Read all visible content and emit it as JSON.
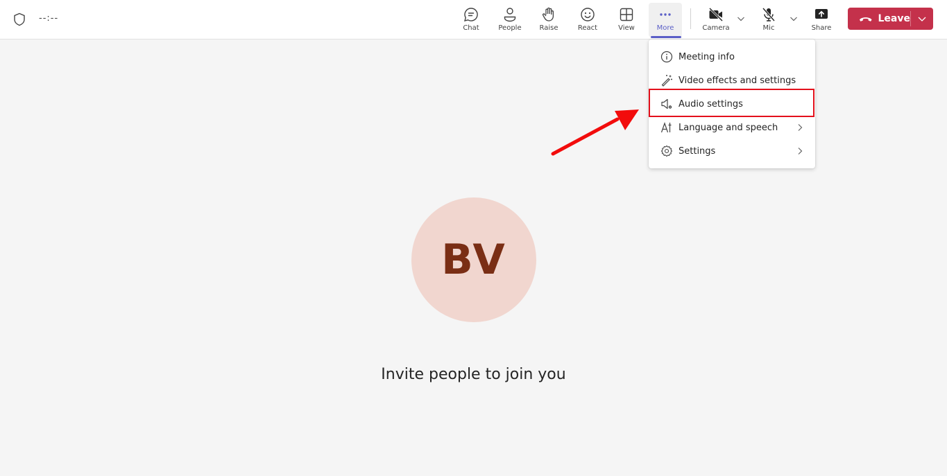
{
  "header": {
    "timer": "--:--",
    "toolbar": [
      {
        "id": "chat",
        "label": "Chat",
        "icon": "chat-icon"
      },
      {
        "id": "people",
        "label": "People",
        "icon": "people-icon"
      },
      {
        "id": "raise",
        "label": "Raise",
        "icon": "hand-icon"
      },
      {
        "id": "react",
        "label": "React",
        "icon": "smiley-icon"
      },
      {
        "id": "view",
        "label": "View",
        "icon": "grid-icon"
      },
      {
        "id": "more",
        "label": "More",
        "icon": "more-icon",
        "active": true
      },
      {
        "id": "camera",
        "label": "Camera",
        "icon": "camera-off-icon"
      },
      {
        "id": "mic",
        "label": "Mic",
        "icon": "mic-off-icon"
      },
      {
        "id": "share",
        "label": "Share",
        "icon": "share-icon"
      }
    ],
    "leave_label": "Leave"
  },
  "more_menu": {
    "items": [
      {
        "label": "Meeting info",
        "icon": "info-icon",
        "submenu": false
      },
      {
        "label": "Video effects and settings",
        "icon": "magic-wand-icon",
        "submenu": false
      },
      {
        "label": "Audio settings",
        "icon": "speaker-settings-icon",
        "submenu": false,
        "highlighted": true
      },
      {
        "label": "Language and speech",
        "icon": "language-icon",
        "submenu": true
      },
      {
        "label": "Settings",
        "icon": "gear-icon",
        "submenu": true
      }
    ]
  },
  "stage": {
    "avatar_initials": "BV",
    "invite_text": "Invite people to join you"
  },
  "colors": {
    "accent": "#5b5fc7",
    "leave": "#c4314b",
    "annotation": "#e3101b",
    "avatar_bg": "#f1d6cf",
    "avatar_text": "#7a2e15"
  }
}
